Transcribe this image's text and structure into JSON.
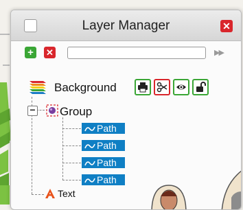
{
  "window": {
    "title": "Layer Manager",
    "close_glyph": "✕"
  },
  "toolbar": {
    "add_glyph": "+",
    "delete_glyph": "✕",
    "search_value": "",
    "search_icon": "search-icon",
    "expand_glyph": "▶▶"
  },
  "layers": {
    "background": {
      "label": "Background",
      "tools": [
        "printer-icon",
        "scissors-icon",
        "eye-icon",
        "unlock-icon"
      ]
    },
    "group": {
      "label": "Group",
      "expander_glyph": "−",
      "children": [
        {
          "label": "Path"
        },
        {
          "label": "Path"
        },
        {
          "label": "Path"
        },
        {
          "label": "Path"
        }
      ]
    },
    "text": {
      "label": "Text"
    }
  },
  "colors": {
    "accent_blue": "#0f7fc4",
    "green": "#3aa635",
    "red": "#d9262c"
  }
}
